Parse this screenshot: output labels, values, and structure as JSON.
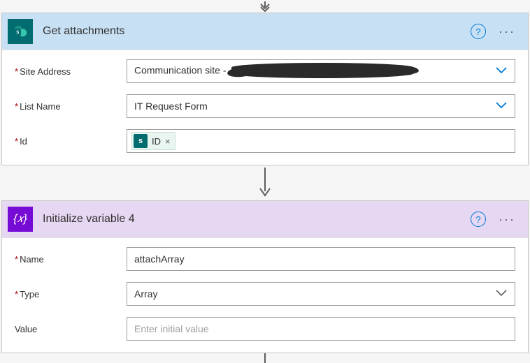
{
  "step1": {
    "title": "Get attachments",
    "fields": {
      "siteAddress": {
        "label": "Site Address",
        "required": true,
        "value_prefix": "Communication site - "
      },
      "listName": {
        "label": "List Name",
        "required": true,
        "value": "IT Request Form"
      },
      "id": {
        "label": "Id",
        "required": true,
        "token_label": "ID"
      }
    }
  },
  "step2": {
    "title": "Initialize variable 4",
    "fields": {
      "name": {
        "label": "Name",
        "required": true,
        "value": "attachArray"
      },
      "type": {
        "label": "Type",
        "required": true,
        "value": "Array"
      },
      "value": {
        "label": "Value",
        "required": false,
        "placeholder": "Enter initial value"
      }
    }
  },
  "icons": {
    "sharepoint_glyph": "S",
    "variable_glyph": "{x}"
  }
}
